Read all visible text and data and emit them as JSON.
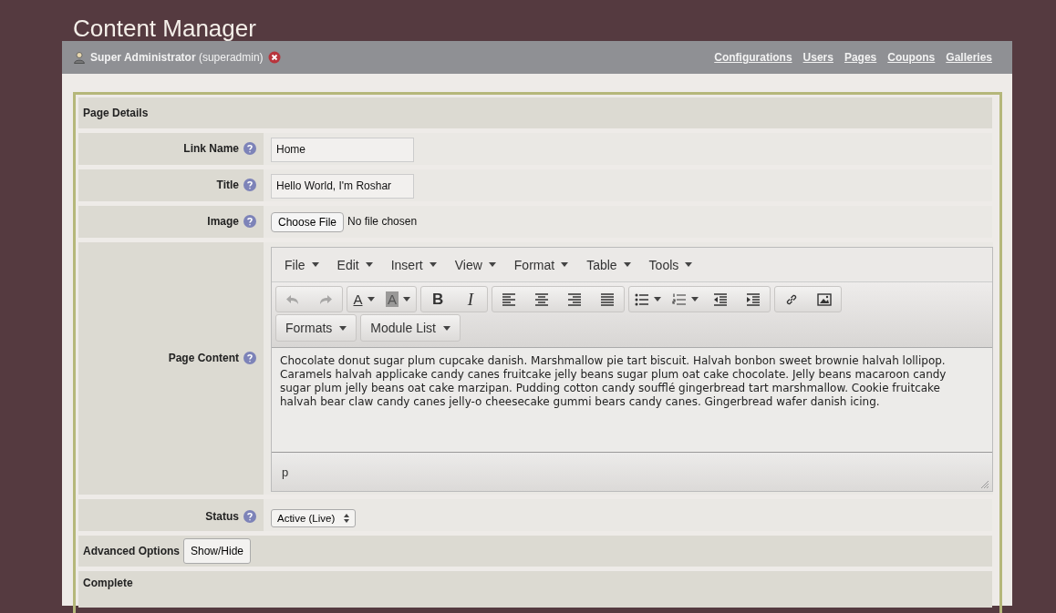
{
  "app_title": "Content Manager",
  "user_bar": {
    "user": "**Super Administrator** (superadmin)",
    "nav": [
      "Configurations",
      "Users",
      "Pages",
      "Coupons",
      "Galleries"
    ]
  },
  "section": "Page Details",
  "fields": [
    {
      "kind": "text",
      "label": "Link Name",
      "value": "Home"
    },
    {
      "kind": "text",
      "label": "Title",
      "value": "Hello World, I'm Roshar"
    },
    {
      "kind": "file",
      "label": "Image",
      "button": "Choose File",
      "value": "No file chosen"
    },
    {
      "kind": "editor",
      "label": "Page Content"
    },
    {
      "kind": "select",
      "label": "Status",
      "value": "Active (Live)"
    }
  ],
  "editor": {
    "menus": [
      "File",
      "Edit",
      "Insert",
      "View",
      "Format",
      "Table",
      "Tools"
    ],
    "toolbar": [
      [
        {
          "kind": "undo",
          "disabled": true
        },
        {
          "kind": "redo",
          "disabled": true
        }
      ],
      [
        {
          "kind": "forecolor",
          "label": "A",
          "dropdown": true
        },
        {
          "kind": "backcolor",
          "label": "A",
          "dropdown": true
        }
      ],
      [
        {
          "kind": "bold",
          "label": "B"
        },
        {
          "kind": "italic",
          "label": "I"
        }
      ],
      [
        {
          "kind": "alignleft"
        },
        {
          "kind": "aligncenter"
        },
        {
          "kind": "alignright"
        },
        {
          "kind": "justify"
        }
      ],
      [
        {
          "kind": "bullist",
          "dropdown": true
        },
        {
          "kind": "numlist",
          "dropdown": true
        },
        {
          "kind": "outdent"
        },
        {
          "kind": "indent"
        }
      ],
      [
        {
          "kind": "link"
        },
        {
          "kind": "image"
        }
      ]
    ],
    "toolbar2": [
      {
        "label": "Formats"
      },
      {
        "label": "Module List"
      }
    ],
    "content": "Chocolate donut sugar plum cupcake danish. Marshmallow pie tart biscuit. Halvah bonbon sweet brownie halvah lollipop. Caramels halvah applicake candy canes fruitcake jelly beans sugar plum oat cake chocolate. Jelly beans macaroon candy sugar plum jelly beans oat cake marzipan. Pudding cotton candy soufflé gingerbread tart marshmallow. Cookie fruitcake halvah bear claw candy canes jelly-o cheesecake gummi bears candy canes. Gingerbread wafer danish icing.",
    "path": "p"
  },
  "advanced": {
    "label": "Advanced Options",
    "button": "Show/Hide"
  },
  "complete": "Complete"
}
